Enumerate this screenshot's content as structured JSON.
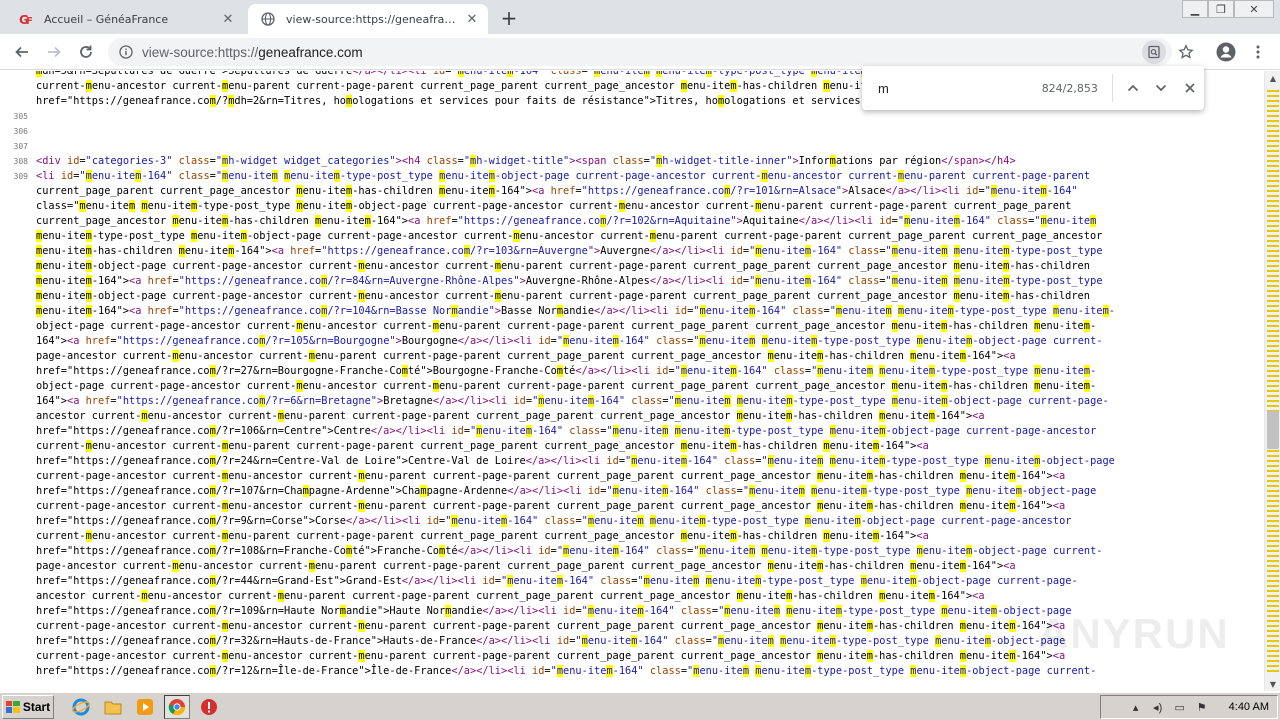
{
  "tabs": [
    {
      "title": "Accueil – GénéaFrance",
      "favicon": "geneafrance-icon",
      "active": false
    },
    {
      "title": "view-source:https://geneafrance.com",
      "favicon": "globe-icon",
      "active": true
    }
  ],
  "new_tab_symbol": "+",
  "address_bar": {
    "scheme": "view-source:https://",
    "host": "geneafrance.com"
  },
  "find_bar": {
    "query": "m",
    "count": "824/2,853"
  },
  "watermark": "ANYRUN",
  "taskbar": {
    "start_label": "Start",
    "clock": "4:40 AM"
  },
  "source_lines": [
    {
      "num": "",
      "text": "mdh=5&rn=Sépultures de Guerre\">Sépultures de Guerre</a></li><li id=\"menu-item-164\" class=\"menu-item menu-item-type-post_type menu-item-object-page current-page-ancestor"
    },
    {
      "num": "",
      "text": "current-menu-ancestor current-menu-parent current-page-parent current_page_parent current_page_ancestor menu-item-has-children menu-item-164\"><a"
    },
    {
      "num": "",
      "text": "href=\"https://geneafrance.com/?mdh=2&rn=Titres, homologations et services pour faits de résistance\">Titres, homologations et services pour faits de résistance</a></li><br>"
    },
    {
      "num": "305",
      "text": ""
    },
    {
      "num": "306",
      "text": ""
    },
    {
      "num": "307",
      "text": ""
    },
    {
      "num": "308",
      "text": "<div id=\"categories-3\" class=\"mh-widget widget_categories\"><h4 class=\"mh-widget-title\"><span class=\"mh-widget-title-inner\">Informations par région</span></h4>"
    },
    {
      "num": "309",
      "text": "<li id=\"menu-item-164\" class=\"menu-item menu-item-type-post_type menu-item-object-page current-page-ancestor current-menu-ancestor current-menu-parent current-page-parent"
    },
    {
      "num": "",
      "text": "current_page_parent current_page_ancestor menu-item-has-children menu-item-164\"><a href=\"https://geneafrance.com/?r=101&rn=Alsace\">Alsace</a></li><li id=\"menu-item-164\""
    },
    {
      "num": "",
      "text": "class=\"menu-item menu-item-type-post_type menu-item-object-page current-page-ancestor current-menu-ancestor current-menu-parent current-page-parent current_page_parent"
    },
    {
      "num": "",
      "text": "current_page_ancestor menu-item-has-children menu-item-164\"><a href=\"https://geneafrance.com/?r=102&rn=Aquitaine\">Aquitaine</a></li><li id=\"menu-item-164\" class=\"menu-item"
    },
    {
      "num": "",
      "text": "menu-item-type-post_type menu-item-object-page current-page-ancestor current-menu-ancestor current-menu-parent current-page-parent current_page_parent current_page_ancestor"
    },
    {
      "num": "",
      "text": "menu-item-has-children menu-item-164\"><a href=\"https://geneafrance.com/?r=103&rn=Auvergne\">Auvergne</a></li><li id=\"menu-item-164\" class=\"menu-item menu-item-type-post_type"
    },
    {
      "num": "",
      "text": "menu-item-object-page current-page-ancestor current-menu-ancestor current-menu-parent current-page-parent current_page_parent current_page_ancestor menu-item-has-children"
    },
    {
      "num": "",
      "text": "menu-item-164\"><a href=\"https://geneafrance.com/?r=84&rn=Auvergne-Rhône-Alpes\">Auvergne-Rhône-Alpes</a></li><li id=\"menu-item-164\" class=\"menu-item menu-item-type-post_type"
    },
    {
      "num": "",
      "text": "menu-item-object-page current-page-ancestor current-menu-ancestor current-menu-parent current-page-parent current_page_parent current_page_ancestor menu-item-has-children"
    },
    {
      "num": "",
      "text": "menu-item-164\"><a href=\"https://geneafrance.com/?r=104&rn=Basse Normandie\">Basse Normandie</a></li><li id=\"menu-item-164\" class=\"menu-item menu-item-type-post_type menu-item-"
    },
    {
      "num": "",
      "text": "object-page current-page-ancestor current-menu-ancestor current-menu-parent current-page-parent current_page_parent current_page_ancestor menu-item-has-children menu-item-"
    },
    {
      "num": "",
      "text": "164\"><a href=\"https://geneafrance.com/?r=105&rn=Bourgogne\">Bourgogne</a></li><li id=\"menu-item-164\" class=\"menu-item menu-item-type-post_type menu-item-object-page current-"
    },
    {
      "num": "",
      "text": "page-ancestor current-menu-ancestor current-menu-parent current-page-parent current_page_parent current_page_ancestor menu-item-has-children menu-item-164\"><a"
    },
    {
      "num": "",
      "text": "href=\"https://geneafrance.com/?r=27&rn=Bourgogne-Franche-Comté\">Bourgogne-Franche-Comté</a></li><li id=\"menu-item-164\" class=\"menu-item menu-item-type-post_type menu-item-"
    },
    {
      "num": "",
      "text": "object-page current-page-ancestor current-menu-ancestor current-menu-parent current-page-parent current_page_parent current_page_ancestor menu-item-has-children menu-item-"
    },
    {
      "num": "",
      "text": "164\"><a href=\"https://geneafrance.com/?r=6&rn=Bretagne\">Bretagne</a></li><li id=\"menu-item-164\" class=\"menu-item menu-item-type-post_type menu-item-object-page current-page-"
    },
    {
      "num": "",
      "text": "ancestor current-menu-ancestor current-menu-parent current-page-parent current_page_parent current_page_ancestor menu-item-has-children menu-item-164\"><a"
    },
    {
      "num": "",
      "text": "href=\"https://geneafrance.com/?r=106&rn=Centre\">Centre</a></li><li id=\"menu-item-164\" class=\"menu-item menu-item-type-post_type menu-item-object-page current-page-ancestor"
    },
    {
      "num": "",
      "text": "current-menu-ancestor current-menu-parent current-page-parent current_page_parent current_page_ancestor menu-item-has-children menu-item-164\"><a"
    },
    {
      "num": "",
      "text": "href=\"https://geneafrance.com/?r=24&rn=Centre-Val de Loire\">Centre-Val de Loire</a></li><li id=\"menu-item-164\" class=\"menu-item menu-item-type-post_type menu-item-object-page"
    },
    {
      "num": "",
      "text": "current-page-ancestor current-menu-ancestor current-menu-parent current-page-parent current_page_parent current_page_ancestor menu-item-has-children menu-item-164\"><a"
    },
    {
      "num": "",
      "text": "href=\"https://geneafrance.com/?r=107&rn=Champagne-Ardenne\">Champagne-Ardenne</a></li><li id=\"menu-item-164\" class=\"menu-item menu-item-type-post_type menu-item-object-page"
    },
    {
      "num": "",
      "text": "current-page-ancestor current-menu-ancestor current-menu-parent current-page-parent current_page_parent current_page_ancestor menu-item-has-children menu-item-164\"><a"
    },
    {
      "num": "",
      "text": "href=\"https://geneafrance.com/?r=9&rn=Corse\">Corse</a></li><li id=\"menu-item-164\" class=\"menu-item menu-item-type-post_type menu-item-object-page current-page-ancestor"
    },
    {
      "num": "",
      "text": "current-menu-ancestor current-menu-parent current-page-parent current_page_parent current_page_ancestor menu-item-has-children menu-item-164\"><a"
    },
    {
      "num": "",
      "text": "href=\"https://geneafrance.com/?r=108&rn=Franche-Comté\">Franche-Comté</a></li><li id=\"menu-item-164\" class=\"menu-item menu-item-type-post_type menu-item-object-page current-"
    },
    {
      "num": "",
      "text": "page-ancestor current-menu-ancestor current-menu-parent current-page-parent current_page_parent current_page_ancestor menu-item-has-children menu-item-164\"><a"
    },
    {
      "num": "",
      "text": "href=\"https://geneafrance.com/?r=44&rn=Grand-Est\">Grand-Est</a></li><li id=\"menu-item-164\" class=\"menu-item menu-item-type-post_type menu-item-object-page current-page-"
    },
    {
      "num": "",
      "text": "ancestor current-menu-ancestor current-menu-parent current-page-parent current_page_parent current_page_ancestor menu-item-has-children menu-item-164\"><a"
    },
    {
      "num": "",
      "text": "href=\"https://geneafrance.com/?r=109&rn=Haute Normandie\">Haute Normandie</a></li><li id=\"menu-item-164\" class=\"menu-item menu-item-type-post_type menu-item-object-page"
    },
    {
      "num": "",
      "text": "current-page-ancestor current-menu-ancestor current-menu-parent current-page-parent current_page_parent current_page_ancestor menu-item-has-children menu-item-164\"><a"
    },
    {
      "num": "",
      "text": "href=\"https://geneafrance.com/?r=32&rn=Hauts-de-France\">Hauts-de-France</a></li><li id=\"menu-item-164\" class=\"menu-item menu-item-type-post_type menu-item-object-page"
    },
    {
      "num": "",
      "text": "current-page-ancestor current-menu-ancestor current-menu-parent current-page-parent current_page_parent current_page_ancestor menu-item-has-children menu-item-164\"><a"
    },
    {
      "num": "",
      "text": "href=\"https://geneafrance.com/?r=12&rn=Île-de-France\">Île-de-France</a></li><li id=\"menu-item-164\" class=\"menu-item menu-item-type-post_type menu-item-object-page current-"
    }
  ]
}
